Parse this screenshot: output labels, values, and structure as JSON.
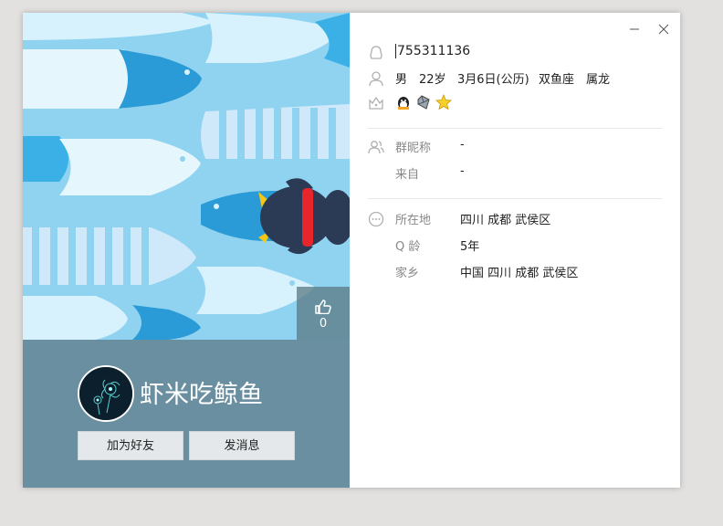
{
  "profile": {
    "nickname": "虾米吃鲸鱼",
    "likes": "0",
    "add_friend_label": "加为好友",
    "send_message_label": "发消息"
  },
  "info": {
    "qq_number": "755311136",
    "gender": "男",
    "age": "22岁",
    "birthday": "3月6日(公历)",
    "zodiac": "双鱼座",
    "chinese_zodiac": "属龙",
    "badge_icons": [
      "penguin-badge-icon",
      "diamond-badge-icon",
      "star-badge-icon"
    ],
    "group_nickname_label": "群昵称",
    "group_nickname_value": "-",
    "from_label": "来自",
    "from_value": "-",
    "location_label": "所在地",
    "location_value": "四川 成都 武侯区",
    "qage_label": "Q 龄",
    "qage_value": "5年",
    "hometown_label": "家乡",
    "hometown_value": "中国 四川 成都 武侯区"
  },
  "colors": {
    "cover_bg": "#8fd3f0",
    "bottom_panel": "#6a8fa1",
    "icon_gray": "#b0b0b0"
  }
}
